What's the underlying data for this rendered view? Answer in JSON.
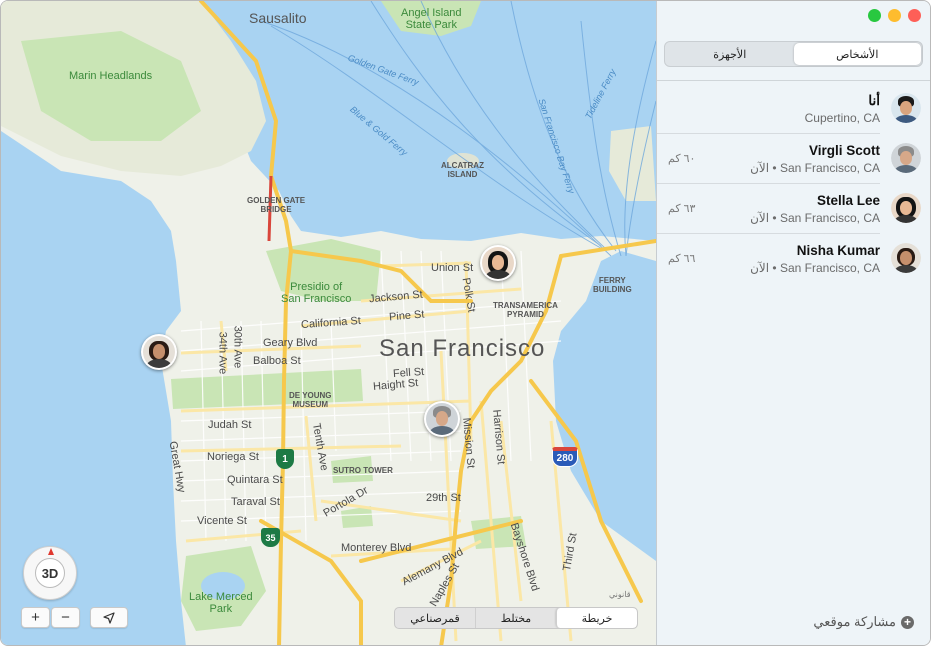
{
  "map": {
    "labels": {
      "sausalito": "Sausalito",
      "angel_island": "Angel Island\nState Park",
      "marin_headlands": "Marin Headlands",
      "golden_gate_ferry": "Golden Gate Ferry",
      "blue_gold_ferry": "Blue & Gold Ferry",
      "sf_bay_ferry": "San Francisco Bay Ferry",
      "tideline_ferry": "Tideline Ferry",
      "alcatraz": "ALCATRAZ\nISLAND",
      "golden_gate_bridge": "GOLDEN GATE\nBRIDGE",
      "presidio": "Presidio of\nSan Francisco",
      "union_st": "Union St",
      "jackson_st": "Jackson St",
      "pine_st": "Pine St",
      "california_st": "California St",
      "polk_st": "Polk St",
      "transamerica": "TRANSAMERICA\nPYRAMID",
      "ferry_building": "FERRY\nBUILDING",
      "san_francisco": "San Francisco",
      "geary_blvd": "Geary Blvd",
      "balboa_st": "Balboa St",
      "30th_ave": "30th Ave",
      "34th_ave": "34th Ave",
      "fell_st": "Fell St",
      "haight_st": "Haight St",
      "de_young": "DE YOUNG\nMUSEUM",
      "judah_st": "Judah St",
      "noriega_st": "Noriega St",
      "quintara_st": "Quintara St",
      "taraval_st": "Taraval St",
      "vicente_st": "Vicente St",
      "great_hwy": "Great Hwy",
      "tenth_ave": "Tenth Ave",
      "sutro_tower": "SUTRO TOWER",
      "portola_dr": "Portola Dr",
      "29th_st": "29th St",
      "harrison_st": "Harrison St",
      "mission_st": "Mission St",
      "monterey_blvd": "Monterey Blvd",
      "alemany_blvd": "Alemany Blvd",
      "naples_st": "Naples St",
      "bayshore_blvd": "Bayshore Blvd",
      "third_st": "Third St",
      "lake_merced": "Lake Merced\nPark",
      "route_1": "1",
      "route_35": "35",
      "route_280": "280"
    },
    "compass_label": "3D",
    "zoom_in": "+",
    "zoom_out": "−",
    "location_icon": "location-arrow-icon",
    "legal": "قانوني",
    "view_modes": [
      "قمرصناعي",
      "مختلط",
      "خريطة"
    ],
    "selected_view": "خريطة"
  },
  "sidebar": {
    "tabs": [
      "الأجهزة",
      "الأشخاص"
    ],
    "selected_tab": "الأشخاص",
    "people": [
      {
        "name": "أنا",
        "location": "Cupertino, CA",
        "distance": ""
      },
      {
        "name": "Virgli Scott",
        "location": "San Francisco, CA • الآن",
        "distance": "٦٠ كم"
      },
      {
        "name": "Stella Lee",
        "location": "San Francisco, CA • الآن",
        "distance": "٦٣ كم"
      },
      {
        "name": "Nisha Kumar",
        "location": "San Francisco, CA • الآن",
        "distance": "٦٦ كم"
      }
    ],
    "share_label": "مشاركة موقعي"
  },
  "colors": {
    "water": "#a9d3f2",
    "park": "#c9e5b5",
    "highway": "#f6c84c",
    "road": "#fbe7a6",
    "close": "#fe5f57",
    "minimize": "#febc2e",
    "zoom": "#28c840"
  }
}
